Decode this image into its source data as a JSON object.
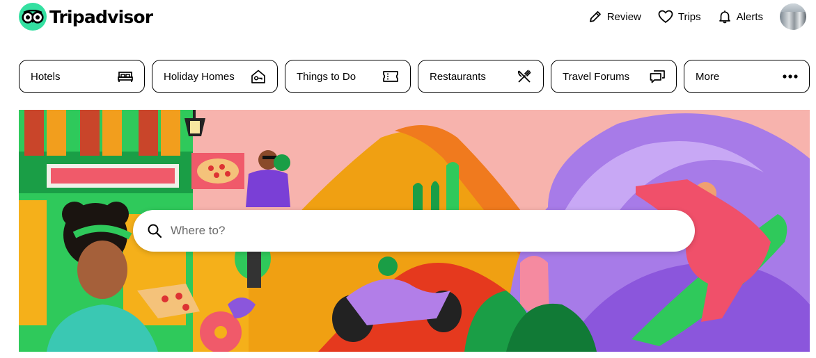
{
  "brand": {
    "name": "Tripadvisor",
    "accent": "#34e0a1"
  },
  "header_nav": [
    {
      "label": "Review",
      "icon": "pencil-icon"
    },
    {
      "label": "Trips",
      "icon": "heart-icon"
    },
    {
      "label": "Alerts",
      "icon": "bell-icon"
    }
  ],
  "tabs": [
    {
      "label": "Hotels",
      "icon": "bed-icon"
    },
    {
      "label": "Holiday Homes",
      "icon": "house-key-icon"
    },
    {
      "label": "Things to Do",
      "icon": "ticket-icon"
    },
    {
      "label": "Restaurants",
      "icon": "fork-knife-icon"
    },
    {
      "label": "Travel Forums",
      "icon": "chat-bubbles-icon"
    },
    {
      "label": "More",
      "icon": "more-dots-icon"
    }
  ],
  "search": {
    "placeholder": "Where to?"
  }
}
